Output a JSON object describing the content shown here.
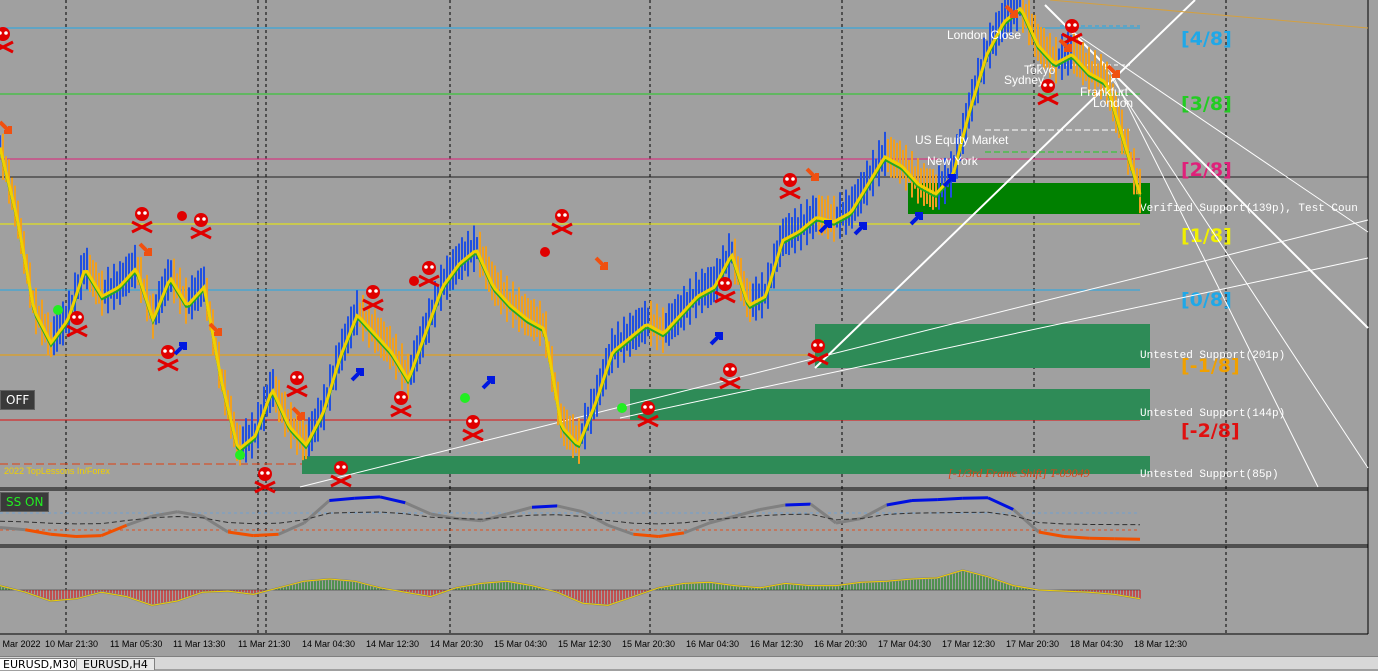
{
  "chart_data": {
    "type": "candlestick",
    "symbol": "EURUSD",
    "timeframe": "M30",
    "time_labels": [
      "10 Mar 2022",
      "10 Mar 21:30",
      "11 Mar 05:30",
      "11 Mar 13:30",
      "11 Mar 21:30",
      "14 Mar 04:30",
      "14 Mar 12:30",
      "14 Mar 20:30",
      "15 Mar 04:30",
      "15 Mar 12:30",
      "15 Mar 20:30",
      "16 Mar 04:30",
      "16 Mar 12:30",
      "16 Mar 20:30",
      "17 Mar 04:30",
      "17 Mar 12:30",
      "17 Mar 20:30",
      "18 Mar 04:30",
      "18 Mar 12:30"
    ],
    "price_series_relative": [
      0.7,
      0.55,
      0.35,
      0.28,
      0.33,
      0.44,
      0.38,
      0.4,
      0.44,
      0.33,
      0.42,
      0.36,
      0.4,
      0.2,
      0.05,
      0.08,
      0.18,
      0.1,
      0.06,
      0.13,
      0.25,
      0.34,
      0.3,
      0.26,
      0.2,
      0.3,
      0.4,
      0.45,
      0.48,
      0.4,
      0.36,
      0.33,
      0.31,
      0.1,
      0.06,
      0.15,
      0.26,
      0.29,
      0.32,
      0.3,
      0.34,
      0.38,
      0.4,
      0.47,
      0.36,
      0.38,
      0.5,
      0.52,
      0.55,
      0.54,
      0.56,
      0.62,
      0.68,
      0.66,
      0.62,
      0.6,
      0.64,
      0.78,
      0.9,
      0.97,
      1.0,
      0.92,
      0.88,
      0.9,
      0.86,
      0.84,
      0.72,
      0.6
    ],
    "murrey_levels": [
      {
        "label": "[4/8]",
        "color": "#1fa8e8"
      },
      {
        "label": "[3/8]",
        "color": "#22cc22"
      },
      {
        "label": "[2/8]",
        "color": "#e0207a"
      },
      {
        "label": "[1/8]",
        "color": "#f0f000"
      },
      {
        "label": "[0/8]",
        "color": "#1fa8e8"
      },
      {
        "label": "[-1/8]",
        "color": "#f0a000"
      },
      {
        "label": "[-2/8]",
        "color": "#e01010"
      }
    ],
    "zones": [
      {
        "label": "Verified Support(139p), Test Coun",
        "kind": "verified"
      },
      {
        "label": "Untested Support(201p)",
        "kind": "untested"
      },
      {
        "label": "Untested Support(144p)",
        "kind": "untested"
      },
      {
        "label": "Untested Support(85p)",
        "kind": "untested"
      }
    ],
    "sessions": [
      "London Close",
      "Tokyo",
      "Sydney",
      "Frankfurt",
      "London",
      "US Equity Market",
      "New York"
    ],
    "frame_note": "[-1/3rd Frame Shift] T-09049",
    "copyright": "2022 TopLessons In/Forex",
    "oscillator_1": [
      0.3,
      0.25,
      0.15,
      0.1,
      0.12,
      0.35,
      0.55,
      0.65,
      0.55,
      0.2,
      0.12,
      0.15,
      0.4,
      0.9,
      0.95,
      0.98,
      0.85,
      0.6,
      0.5,
      0.45,
      0.6,
      0.75,
      0.78,
      0.65,
      0.35,
      0.15,
      0.1,
      0.18,
      0.4,
      0.55,
      0.7,
      0.8,
      0.82,
      0.4,
      0.5,
      0.8,
      0.9,
      0.92,
      0.95,
      0.96,
      0.7,
      0.2,
      0.1,
      0.06,
      0.05,
      0.04
    ],
    "oscillator_2": [
      0.2,
      -0.1,
      -0.5,
      -0.4,
      -0.1,
      -0.3,
      -0.7,
      -0.5,
      -0.1,
      -0.05,
      -0.2,
      0.1,
      0.4,
      0.5,
      0.4,
      0.1,
      -0.1,
      -0.3,
      0.1,
      0.3,
      0.4,
      0.2,
      -0.1,
      -0.6,
      -0.7,
      -0.3,
      0.1,
      0.3,
      0.35,
      0.2,
      0.1,
      0.3,
      0.2,
      0.2,
      0.35,
      0.4,
      0.5,
      0.55,
      0.9,
      0.6,
      0.2,
      0.0,
      -0.05,
      -0.1,
      -0.2,
      -0.4
    ]
  },
  "ui": {
    "off_button": "OFF",
    "loss_on_button": "SS ON",
    "tabs": [
      "EURUSD,M30",
      "EURUSD,H4"
    ]
  }
}
